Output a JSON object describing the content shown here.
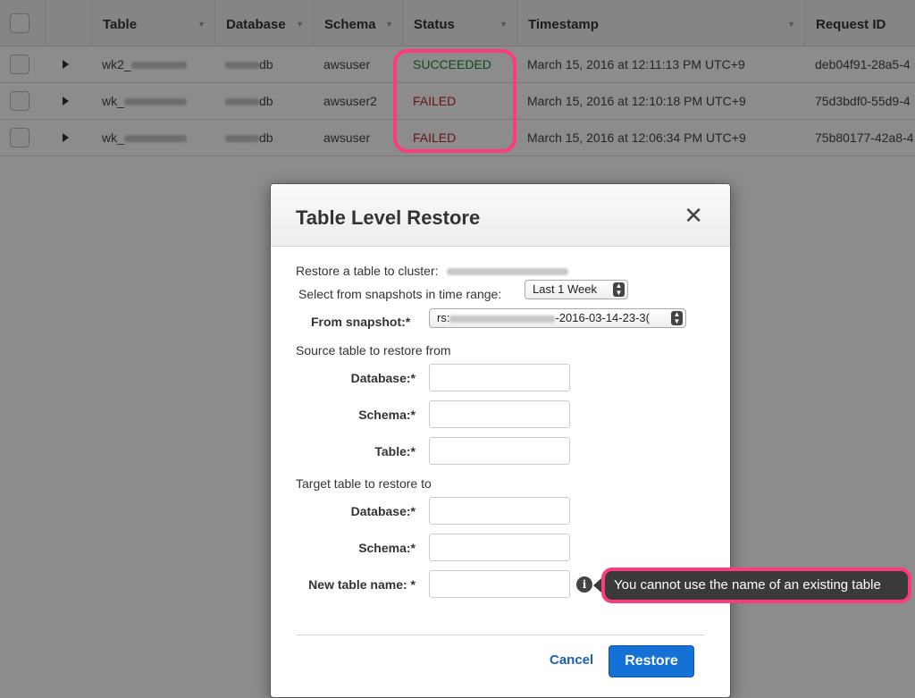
{
  "table": {
    "columns": [
      "Table",
      "Database",
      "Schema",
      "Status",
      "Timestamp",
      "Request ID"
    ],
    "rows": [
      {
        "table": "wk2_",
        "database": "db",
        "schema": "awsuser",
        "status": "SUCCEEDED",
        "timestamp": "March 15, 2016 at 12:11:13 PM UTC+9",
        "request_id": "deb04f91-28a5-4"
      },
      {
        "table": "wk_",
        "database": "db",
        "schema": "awsuser2",
        "status": "FAILED",
        "timestamp": "March 15, 2016 at 12:10:18 PM UTC+9",
        "request_id": "75d3bdf0-55d9-4"
      },
      {
        "table": "wk_",
        "database": "db",
        "schema": "awsuser",
        "status": "FAILED",
        "timestamp": "March 15, 2016 at 12:06:34 PM UTC+9",
        "request_id": "75b80177-42a8-4"
      }
    ]
  },
  "modal": {
    "title": "Table Level Restore",
    "close_glyph": "✕",
    "restore_to_cluster_label": "Restore a table to cluster:",
    "time_range_label": "Select from snapshots in time range:",
    "time_range_value": "Last 1 Week",
    "from_snapshot_label": "From snapshot:*",
    "from_snapshot_value_prefix": "rs:",
    "from_snapshot_value_suffix": "-2016-03-14-23-3(",
    "source_section": "Source table to restore from",
    "target_section": "Target table to restore to",
    "database_label": "Database:*",
    "schema_label": "Schema:*",
    "table_label": "Table:*",
    "new_table_label": "New table name: *",
    "info_glyph": "i",
    "cancel_label": "Cancel",
    "restore_label": "Restore"
  },
  "tooltip": {
    "text": "You cannot use the name of an existing table"
  },
  "colors": {
    "succeeded": "#1d8a3a",
    "failed": "#c0272d",
    "highlight": "#ff3a7a",
    "primary_button": "#1571d6"
  }
}
